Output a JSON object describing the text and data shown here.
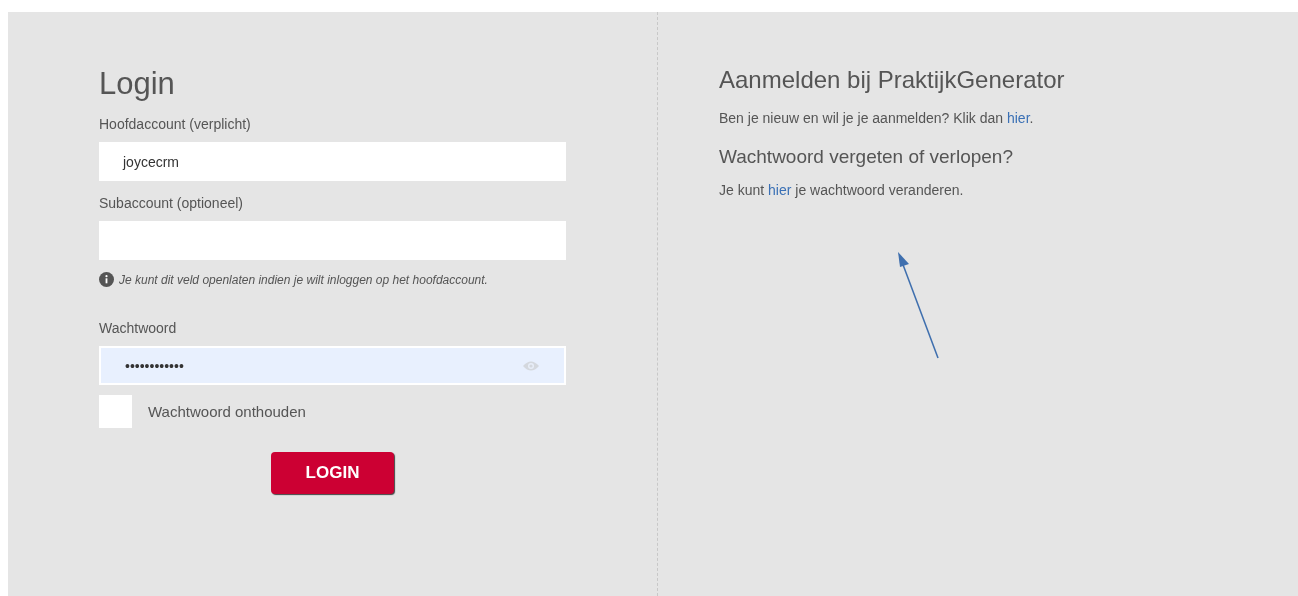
{
  "login": {
    "title": "Login",
    "fields": [
      {
        "label": "Hoofdaccount (verplicht)",
        "value": "joycecrm",
        "kind": "text"
      },
      {
        "label": "Subaccount (optioneel)",
        "kind": "text",
        "hint": "Je kunt dit veld openlaten indien je wilt inloggen op het hoofdaccount."
      },
      {
        "label": "Wachtwoord",
        "value": "••••••••••••",
        "kind": "password"
      }
    ],
    "remember": {
      "label": "Wachtwoord onthouden",
      "checked": false
    },
    "button": "LOGIN"
  },
  "register": {
    "title": "Aanmelden bij PraktijkGenerator",
    "text": {
      "before": "Ben je nieuw en wil je je aanmelden? Klik dan ",
      "link": "hier",
      "after": "."
    },
    "subtitle": "Wachtwoord vergeten of verlopen?",
    "text2": {
      "before": "Je kunt ",
      "link": "hier",
      "after": " je wachtwoord veranderen."
    }
  }
}
